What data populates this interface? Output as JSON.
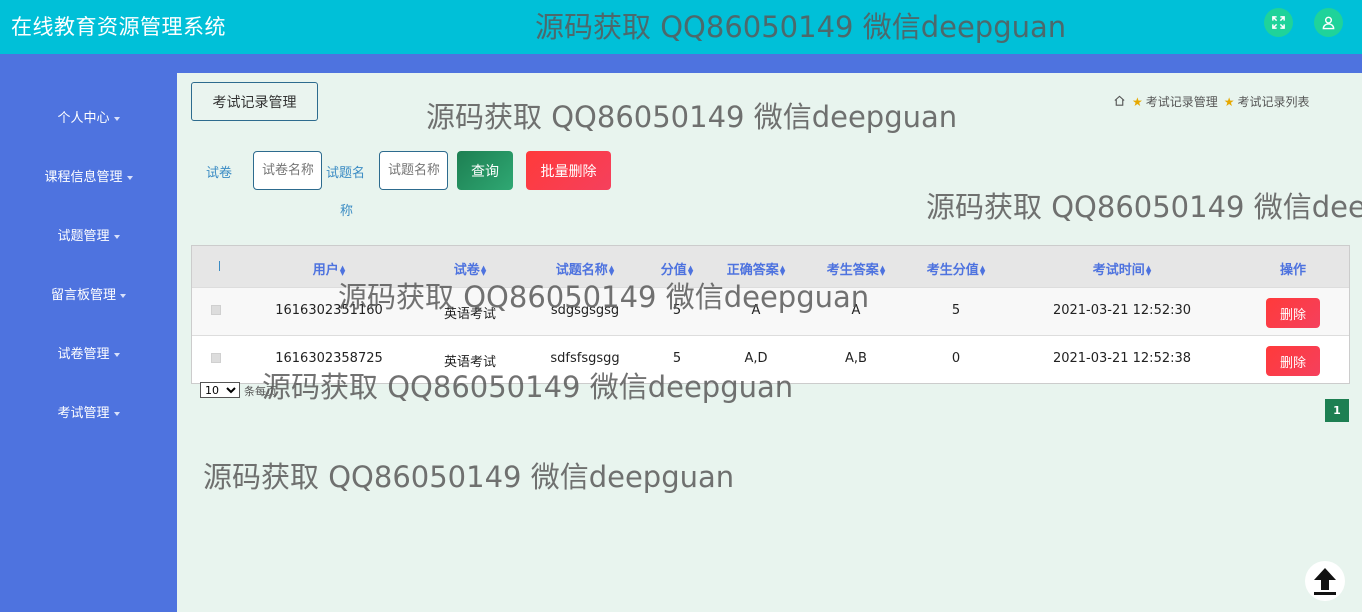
{
  "header": {
    "title": "在线教育资源管理系统",
    "fullscreen_icon": "expand-icon",
    "user_icon": "user-icon"
  },
  "watermark": "源码获取 QQ86050149 微信deepguan",
  "sidebar": {
    "items": [
      {
        "label": "个人中心"
      },
      {
        "label": "课程信息管理"
      },
      {
        "label": "试题管理"
      },
      {
        "label": "留言板管理"
      },
      {
        "label": "试卷管理"
      },
      {
        "label": "考试管理"
      }
    ]
  },
  "page": {
    "title_button": "考试记录管理",
    "breadcrumb": [
      "考试记录管理",
      "考试记录列表"
    ]
  },
  "search": {
    "paper_label": "试卷",
    "paper_placeholder": "试卷名称",
    "question_label_1": "试题名",
    "question_label_2": "称",
    "question_placeholder": "试题名称",
    "query_button": "查询",
    "bulk_delete_button": "批量删除"
  },
  "table": {
    "columns": [
      "用户",
      "试卷",
      "试题名称",
      "分值",
      "正确答案",
      "考生答案",
      "考生分值",
      "考试时间",
      "操作"
    ],
    "rows": [
      {
        "user": "1616302351160",
        "paper": "英语考试",
        "question": "sdgsgsgsg",
        "score": "5",
        "correct": "A",
        "answer": "A",
        "got": "5",
        "time": "2021-03-21 12:52:30",
        "action": "删除"
      },
      {
        "user": "1616302358725",
        "paper": "英语考试",
        "question": "sdfsfsgsgg",
        "score": "5",
        "correct": "A,D",
        "answer": "A,B",
        "got": "0",
        "time": "2021-03-21 12:52:38",
        "action": "删除"
      }
    ]
  },
  "pagination": {
    "page_size": "10",
    "page_size_label": "条每页",
    "current_page": "1"
  },
  "colors": {
    "topbar": "#00c0d8",
    "sidebar": "#4e73df",
    "primary_green": "#1d7f52",
    "danger_red": "#ff3a3a"
  }
}
